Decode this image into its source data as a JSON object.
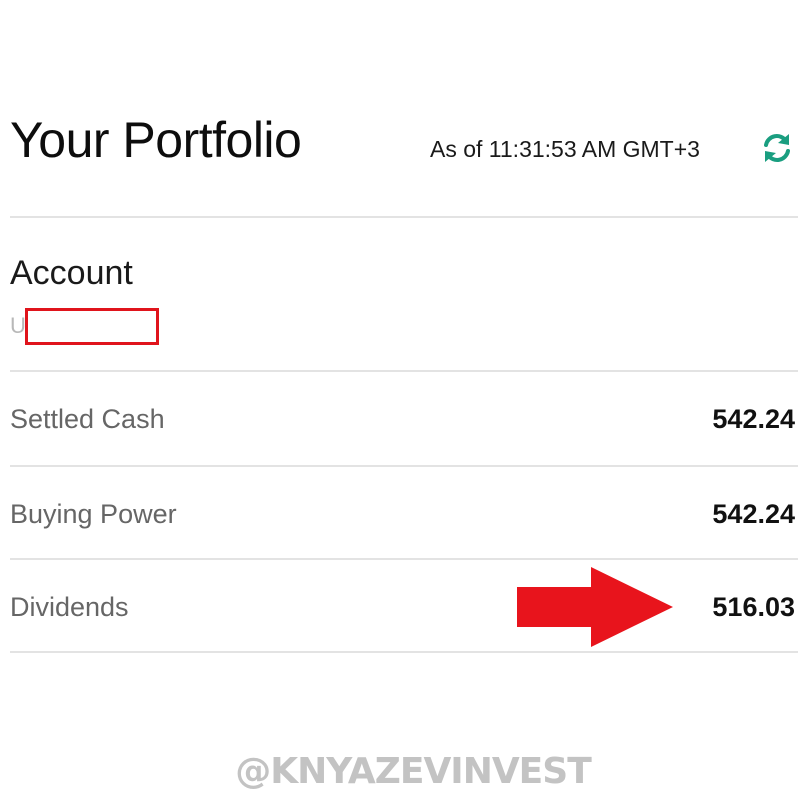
{
  "header": {
    "title": "Your Portfolio",
    "as_of": "As of 11:31:53 AM GMT+3",
    "refresh_icon": "refresh-icon",
    "accent_color": "#1a9e80"
  },
  "account": {
    "label": "Account",
    "id_prefix": "U"
  },
  "rows": [
    {
      "label": "Settled Cash",
      "value": "542.24"
    },
    {
      "label": "Buying Power",
      "value": "542.24"
    },
    {
      "label": "Dividends",
      "value": "516.03"
    }
  ],
  "annotations": {
    "highlight_color": "#e0141c",
    "arrow_icon": "right-arrow-icon"
  },
  "watermark": "@KNYAZEVINVEST"
}
